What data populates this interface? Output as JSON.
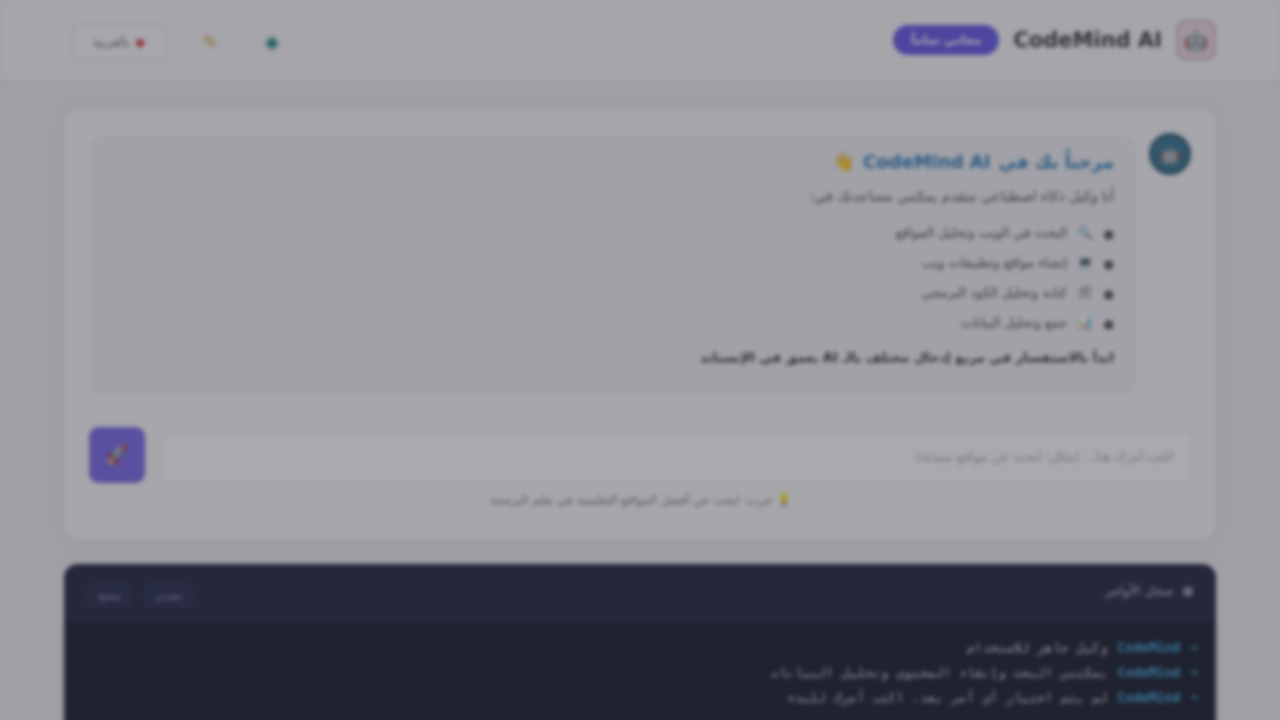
{
  "header": {
    "logo_glyph": "🤖",
    "brand_name": "CodeMind AI",
    "brand_badge": "مجاني تماماً",
    "language_label": "بالعربية",
    "language_dot": "●",
    "tools": [
      {
        "icon": "pencil-icon",
        "glyph": "✎"
      },
      {
        "icon": "globe-icon",
        "glyph": "◆"
      }
    ]
  },
  "chat": {
    "avatar_glyph": "🤖",
    "welcome_prefix": "مرحباً بك في",
    "welcome_brand": "CodeMind AI",
    "welcome_emoji": "👋",
    "intro": "أنا وكيل ذكاء اصطناعي متقدم يمكنني مساعدتك في:",
    "features": [
      {
        "emoji": "🔍",
        "text": "البحث في الويب وتحليل المواقع"
      },
      {
        "emoji": "💻",
        "text": "إنشاء مواقع وتطبيقات ويب"
      },
      {
        "emoji": "🛠",
        "text": "كتابة وتحليل الكود البرمجي"
      },
      {
        "emoji": "📊",
        "text": "جمع وتحليل البيانات"
      }
    ],
    "closing": "ابدأ بالاستفسار في مربع إدخال مختلف بالـ AI بعمق في الإنستاند",
    "input_placeholder": "اكتب أمرك هنا... (مثال: ابحث عن مواقع مبتدئة)",
    "send_glyph": "🚀",
    "hint_emoji": "💡",
    "hint": "جرب: ابحث عن أفضل المواقع التعليمية في تعلم البرمجة"
  },
  "terminal": {
    "title_glyph": "▣",
    "title": "سجل الأوامر",
    "actions": [
      "تصدير",
      "مسح"
    ],
    "lines": [
      {
        "prefix": "CodeMind",
        "text": "وكيل جاهز للاستخدام"
      },
      {
        "prefix": "CodeMind",
        "text": "يمكنني البحث وإنشاء المحتوى وتحليل البيانات"
      },
      {
        "prefix": "CodeMind",
        "text": "لم يتم اختيار أي أمر بعد، اكتب أمرك للبدء"
      }
    ]
  }
}
